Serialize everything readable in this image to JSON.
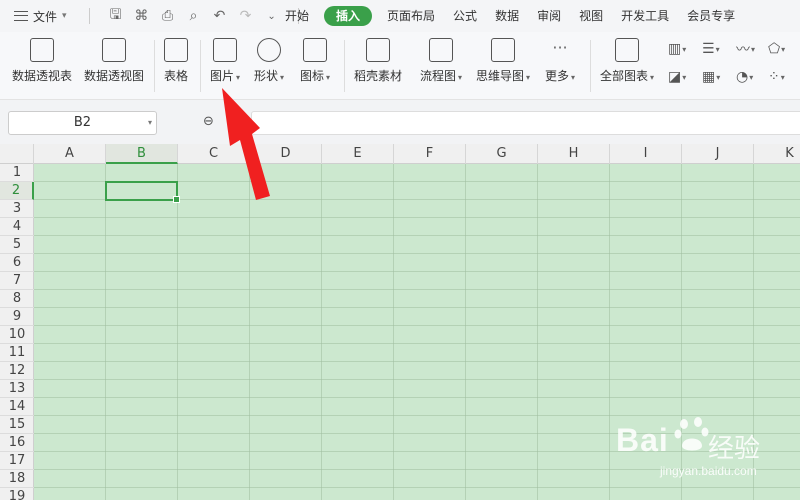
{
  "menubar": {
    "file_label": "文件",
    "tabs": [
      "开始",
      "插入",
      "页面布局",
      "公式",
      "数据",
      "审阅",
      "视图",
      "开发工具",
      "会员专享"
    ],
    "active_tab": "插入"
  },
  "ribbon": {
    "pivot_table": "数据透视表",
    "pivot_chart": "数据透视图",
    "table": "表格",
    "picture": "图片",
    "shape": "形状",
    "icon": "图标",
    "material": "稻壳素材",
    "flowchart": "流程图",
    "mindmap": "思维导图",
    "more": "更多",
    "all_charts": "全部图表"
  },
  "formula_bar": {
    "name_box": "B2",
    "formula": ""
  },
  "sheet": {
    "columns": [
      "A",
      "B",
      "C",
      "D",
      "E",
      "F",
      "G",
      "H",
      "I",
      "J",
      "K"
    ],
    "rows": [
      "1",
      "2",
      "3",
      "4",
      "5",
      "6",
      "7",
      "8",
      "9",
      "10",
      "11",
      "12",
      "13",
      "14",
      "15",
      "16",
      "17",
      "18",
      "19"
    ],
    "selected_cell": "B2",
    "cell_background": "#cce8cf",
    "accent": "#3aa04a"
  },
  "watermark": {
    "brand": "Bai",
    "brand_cn": "经验",
    "url": "jingyan.baidu.com"
  }
}
